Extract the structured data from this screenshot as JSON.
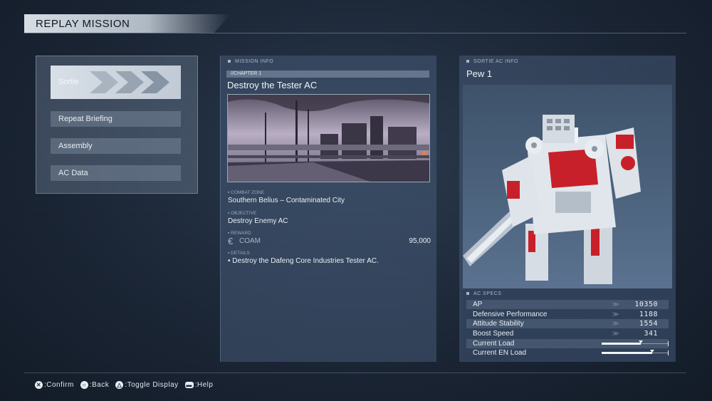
{
  "header": {
    "title": "REPLAY MISSION"
  },
  "menu": {
    "items": [
      {
        "label": "Sortie",
        "selected": true
      },
      {
        "label": "Repeat Briefing"
      },
      {
        "label": "Assembly"
      },
      {
        "label": "AC Data"
      }
    ]
  },
  "mission": {
    "section_label": "MISSION INFO",
    "chapter": "//CHAPTER 1",
    "title": "Destroy the Tester AC",
    "combat_zone_label": "COMBAT ZONE",
    "combat_zone": "Southern Belius – Contaminated City",
    "objective_label": "OBJECTIVE",
    "objective": "Destroy Enemy AC",
    "reward_label": "REWARD",
    "reward_currency_symbol": "€",
    "reward_name": "COAM",
    "reward_amount": "95,000",
    "details_label": "DETAILS",
    "details": "• Destroy the Dafeng Core Industries Tester AC."
  },
  "ac": {
    "section_label": "SORTIE AC INFO",
    "name": "Pew 1",
    "specs_label": "AC SPECS",
    "specs": [
      {
        "name": "AP",
        "value": "10350"
      },
      {
        "name": "Defensive Performance",
        "value": "1188"
      },
      {
        "name": "Attitude Stability",
        "value": "1554"
      },
      {
        "name": "Boost Speed",
        "value": "341"
      },
      {
        "name": "Current Load",
        "gauge": 0.58
      },
      {
        "name": "Current EN Load",
        "gauge": 0.75
      }
    ]
  },
  "footer": {
    "hints": [
      {
        "icon": "cross-button-icon",
        "glyph": "✕",
        "label": ":Confirm"
      },
      {
        "icon": "circle-button-icon",
        "glyph": "○",
        "label": ":Back"
      },
      {
        "icon": "triangle-button-icon",
        "glyph": "△",
        "label": ":Toggle Display"
      },
      {
        "icon": "touchpad-button-icon",
        "glyph": "▬",
        "label": ":Help"
      }
    ]
  },
  "colors": {
    "accent": "#d8dfe7",
    "panel": "#465a76",
    "mech_red": "#c8202a"
  }
}
